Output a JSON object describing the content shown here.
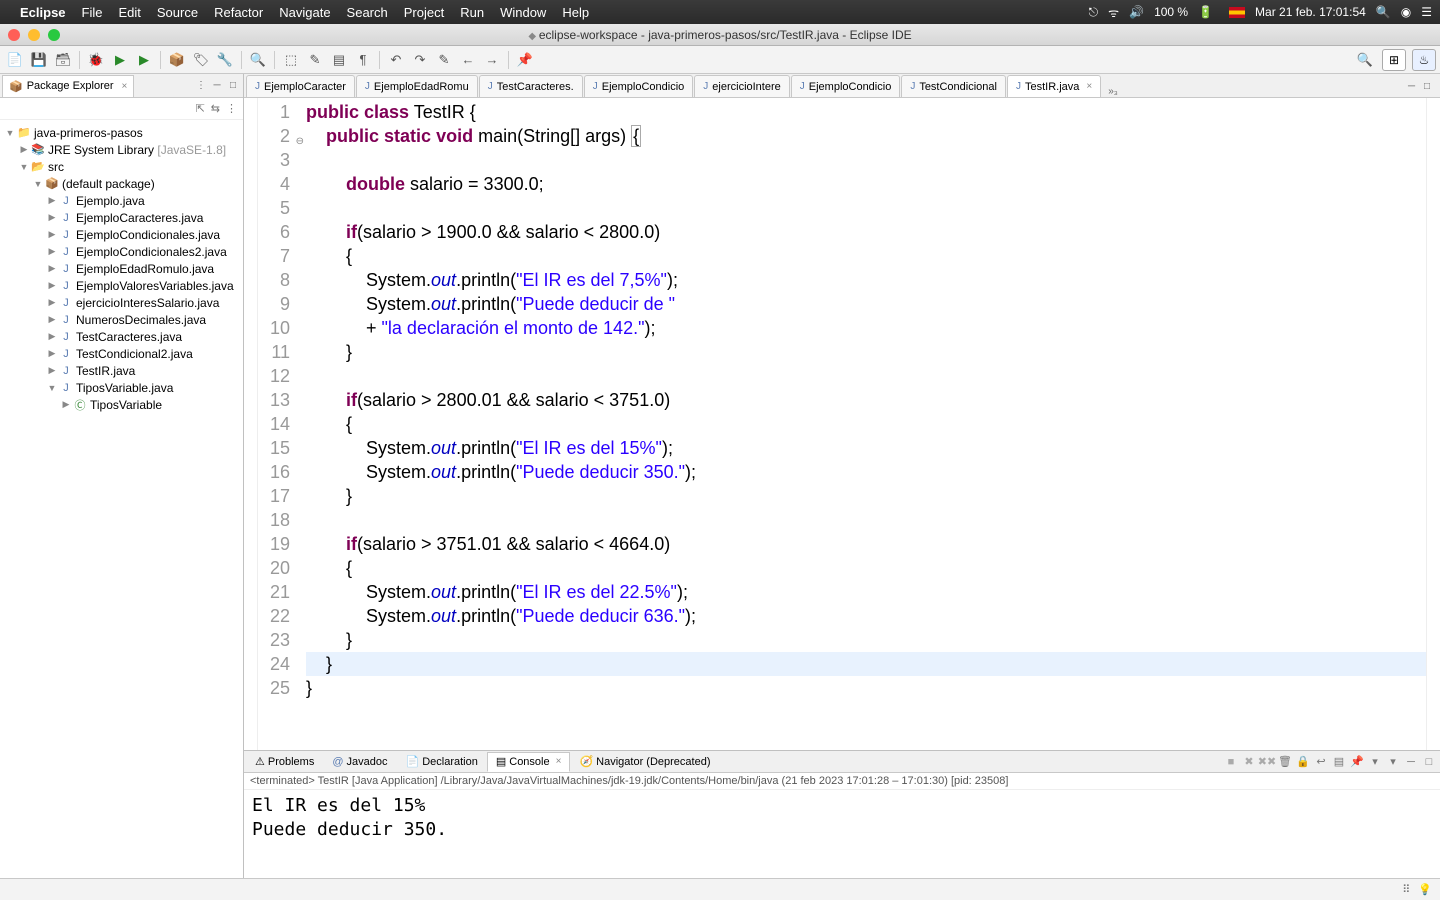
{
  "menubar": {
    "app": "Eclipse",
    "items": [
      "File",
      "Edit",
      "Source",
      "Refactor",
      "Navigate",
      "Search",
      "Project",
      "Run",
      "Window",
      "Help"
    ],
    "battery": "100 %",
    "datetime": "Mar 21 feb.  17:01:54"
  },
  "window_title": "eclipse-workspace - java-primeros-pasos/src/TestIR.java - Eclipse IDE",
  "package_explorer": {
    "title": "Package Explorer",
    "project": "java-primeros-pasos",
    "jre": "JRE System Library",
    "jre_extra": "[JavaSE-1.8]",
    "src": "src",
    "default_pkg": "(default package)",
    "files": [
      "Ejemplo.java",
      "EjemploCaracteres.java",
      "EjemploCondicionales.java",
      "EjemploCondicionales2.java",
      "EjemploEdadRomulo.java",
      "EjemploValoresVariables.java",
      "ejercicioInteresSalario.java",
      "NumerosDecimales.java",
      "TestCaracteres.java",
      "TestCondicional2.java",
      "TestIR.java",
      "TiposVariable.java"
    ],
    "tipos_class": "TiposVariable"
  },
  "editor_tabs": [
    "EjemploCaracter",
    "EjemploEdadRomu",
    "TestCaracteres.",
    "EjemploCondicio",
    "ejercicioIntere",
    "EjemploCondicio",
    "TestCondicional"
  ],
  "active_tab": "TestIR.java",
  "overflow_indicator": "»₃",
  "code_lines": [
    {
      "n": 1,
      "html": "<span class='kw'>public</span> <span class='kw'>class</span> <span class='cname'>TestIR</span> {"
    },
    {
      "n": 2,
      "fold": true,
      "html": "    <span class='kw'>public</span> <span class='kw'>static</span> <span class='kw'>void</span> main(String[] <span class='typ'>args</span>) <span class='boxbrace'>{</span>"
    },
    {
      "n": 3,
      "html": ""
    },
    {
      "n": 4,
      "html": "        <span class='kw'>double</span> salario = 3300.0;"
    },
    {
      "n": 5,
      "html": ""
    },
    {
      "n": 6,
      "html": "        <span class='kw'>if</span>(salario &gt; 1900.0 &amp;&amp; salario &lt; 2800.0)"
    },
    {
      "n": 7,
      "html": "        {"
    },
    {
      "n": 8,
      "html": "            System.<span class='fld'>out</span>.println(<span class='str'>\"El IR es del 7,5%\"</span>);"
    },
    {
      "n": 9,
      "html": "            System.<span class='fld'>out</span>.println(<span class='str'>\"Puede deducir de \"</span>"
    },
    {
      "n": 10,
      "html": "            + <span class='str'>\"la declaración el monto de 142.\"</span>);"
    },
    {
      "n": 11,
      "html": "        }"
    },
    {
      "n": 12,
      "html": ""
    },
    {
      "n": 13,
      "html": "        <span class='kw'>if</span>(salario &gt; 2800.01 &amp;&amp; salario &lt; 3751.0)"
    },
    {
      "n": 14,
      "html": "        {"
    },
    {
      "n": 15,
      "html": "            System.<span class='fld'>out</span>.println(<span class='str'>\"El IR es del 15%\"</span>);"
    },
    {
      "n": 16,
      "html": "            System.<span class='fld'>out</span>.println(<span class='str'>\"Puede deducir 350.\"</span>);"
    },
    {
      "n": 17,
      "html": "        }"
    },
    {
      "n": 18,
      "html": ""
    },
    {
      "n": 19,
      "html": "        <span class='kw'>if</span>(salario &gt; 3751.01 &amp;&amp; salario &lt; 4664.0)"
    },
    {
      "n": 20,
      "html": "        {"
    },
    {
      "n": 21,
      "html": "            System.<span class='fld'>out</span>.println(<span class='str'>\"El IR es del 22.5%\"</span>);"
    },
    {
      "n": 22,
      "html": "            System.<span class='fld'>out</span>.println(<span class='str'>\"Puede deducir 636.\"</span>);"
    },
    {
      "n": 23,
      "html": "        }"
    },
    {
      "n": 24,
      "current": true,
      "html": "    }"
    },
    {
      "n": 25,
      "html": "}"
    }
  ],
  "bottom_tabs": {
    "problems": "Problems",
    "javadoc": "Javadoc",
    "declaration": "Declaration",
    "console": "Console",
    "navigator": "Navigator (Deprecated)"
  },
  "console_header": "<terminated> TestIR [Java Application] /Library/Java/JavaVirtualMachines/jdk-19.jdk/Contents/Home/bin/java  (21 feb 2023 17:01:28 – 17:01:30) [pid: 23508]",
  "console_output": "El IR es del 15%\nPuede deducir 350."
}
